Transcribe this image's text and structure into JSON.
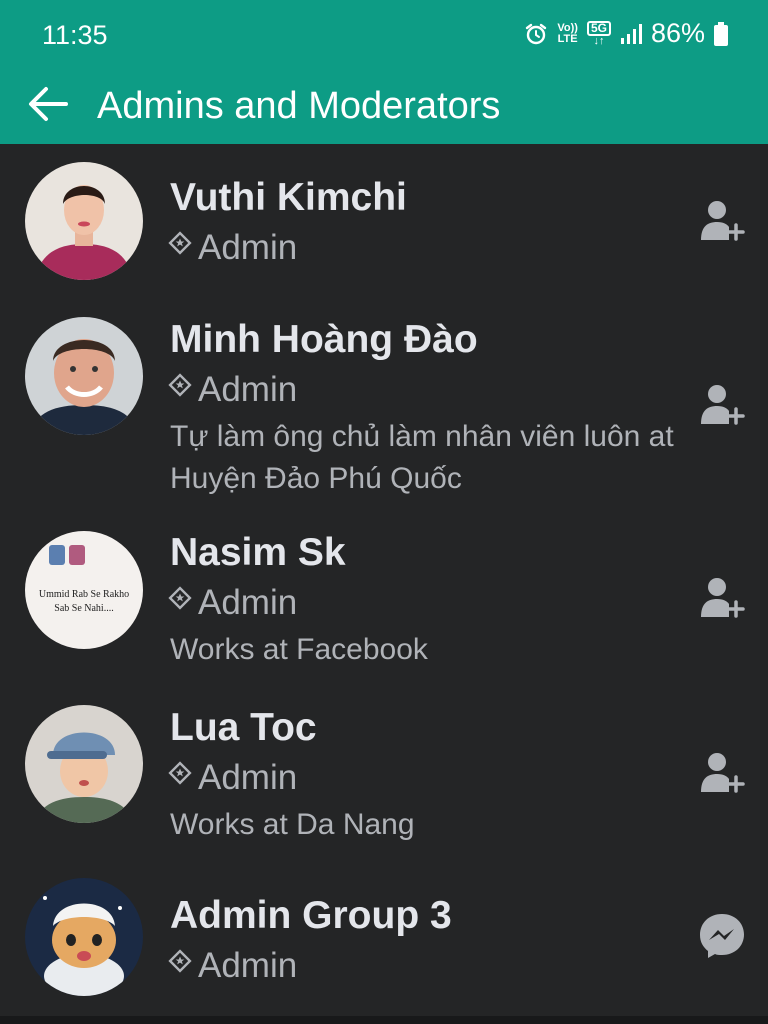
{
  "status_bar": {
    "time": "11:35",
    "volte_label_top": "Vo))",
    "volte_label_bottom": "LTE",
    "network_label": "5G",
    "battery_percent": "86%",
    "icons": [
      "alarm-icon",
      "volte-icon",
      "5g-icon",
      "signal-icon",
      "battery-icon"
    ]
  },
  "app_bar": {
    "title": "Admins and Moderators",
    "back_icon": "arrow-left-icon"
  },
  "members": [
    {
      "name": "Vuthi Kimchi",
      "role": "Admin",
      "detail": "",
      "action_icon": "add-friend-icon"
    },
    {
      "name": "Minh Hoàng Đào",
      "role": "Admin",
      "detail": "Tự làm ông chủ làm nhân viên luôn at Huyện Đảo Phú Quốc",
      "action_icon": "add-friend-icon"
    },
    {
      "name": "Nasim Sk",
      "role": "Admin",
      "detail": "Works at Facebook",
      "action_icon": "add-friend-icon",
      "avatar_text_line1": "Ummid Rab Se Rakho",
      "avatar_text_line2": "Sab Se Nahi...."
    },
    {
      "name": "Lua Toc",
      "role": "Admin",
      "detail": "Works at Da Nang",
      "action_icon": "add-friend-icon"
    },
    {
      "name": "Admin Group 3",
      "role": "Admin",
      "detail": "",
      "action_icon": "messenger-icon"
    }
  ],
  "colors": {
    "header": "#0d9c85",
    "background": "#242526",
    "primary_text": "#e4e6eb",
    "secondary_text": "#b0b3b8"
  }
}
